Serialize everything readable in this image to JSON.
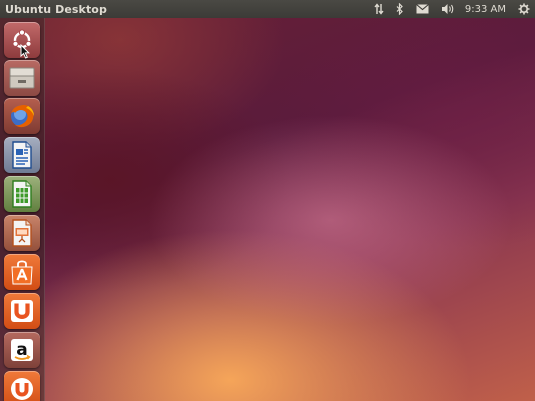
{
  "panel": {
    "title": "Ubuntu Desktop",
    "clock": "9:33 AM",
    "indicators": [
      "network-arrows-icon",
      "bluetooth-icon",
      "mail-icon",
      "volume-icon",
      "gear-icon"
    ]
  },
  "launcher": {
    "items": [
      {
        "name": "dash-home-button",
        "icon": "ubuntu-logo-icon"
      },
      {
        "name": "files-button",
        "icon": "file-cabinet-icon"
      },
      {
        "name": "firefox-button",
        "icon": "firefox-icon"
      },
      {
        "name": "libreoffice-writer-button",
        "icon": "writer-document-icon"
      },
      {
        "name": "libreoffice-calc-button",
        "icon": "calc-spreadsheet-icon"
      },
      {
        "name": "libreoffice-impress-button",
        "icon": "impress-presentation-icon"
      },
      {
        "name": "software-center-button",
        "icon": "shopping-bag-icon"
      },
      {
        "name": "ubuntu-one-button",
        "icon": "ubuntu-one-icon"
      },
      {
        "name": "amazon-button",
        "icon": "amazon-icon"
      },
      {
        "name": "ubuntu-one-music-button",
        "icon": "ubuntu-one-music-icon"
      }
    ],
    "amazon_letter": "a",
    "u_letter": "U"
  },
  "colors": {
    "panel": "#3c3b37",
    "panel_text": "#dfdbd2",
    "orange": "#e95420",
    "aubergine": "#5a1a2a"
  }
}
